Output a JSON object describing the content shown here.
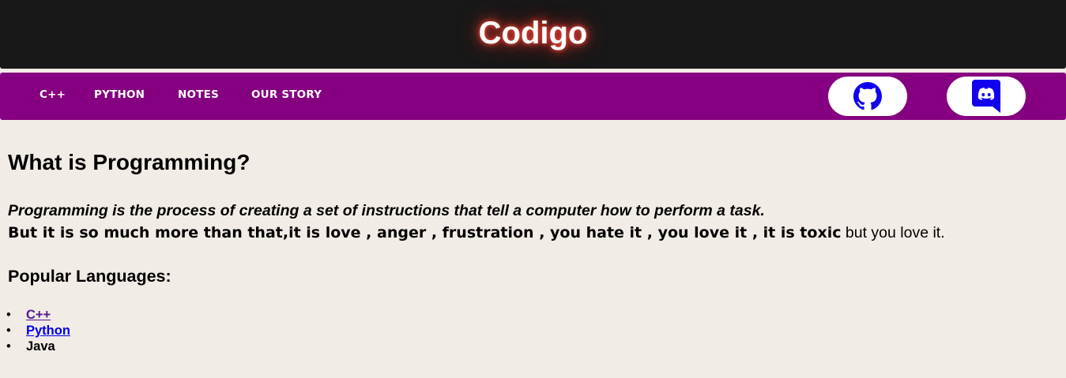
{
  "header": {
    "title": "Codigo",
    "background": "#181818",
    "glow_color": "#e83a2e"
  },
  "nav": {
    "background": "#850080",
    "links": [
      "C++",
      "PYTHON",
      "NOTES",
      "OUR STORY"
    ],
    "github": {
      "icon": "github-icon",
      "color": "#1100ee"
    },
    "discord": {
      "icon": "discord-icon",
      "color": "#1100ee"
    }
  },
  "main": {
    "heading": "What is Programming?",
    "intro": "Programming is the process of creating a set of instructions that tell a computer how to perform a task.",
    "more_bold": "But it is so much more than that,it is love , anger , frustration , you hate it , you love it , it is toxic",
    "more_plain": " but you love it.",
    "languages_heading": "Popular Languages:",
    "languages": [
      "C++",
      "Python",
      "Java"
    ]
  },
  "colors": {
    "page_background": "#f2ece6",
    "visited_link": "#551a8b",
    "link": "#0000ee"
  }
}
